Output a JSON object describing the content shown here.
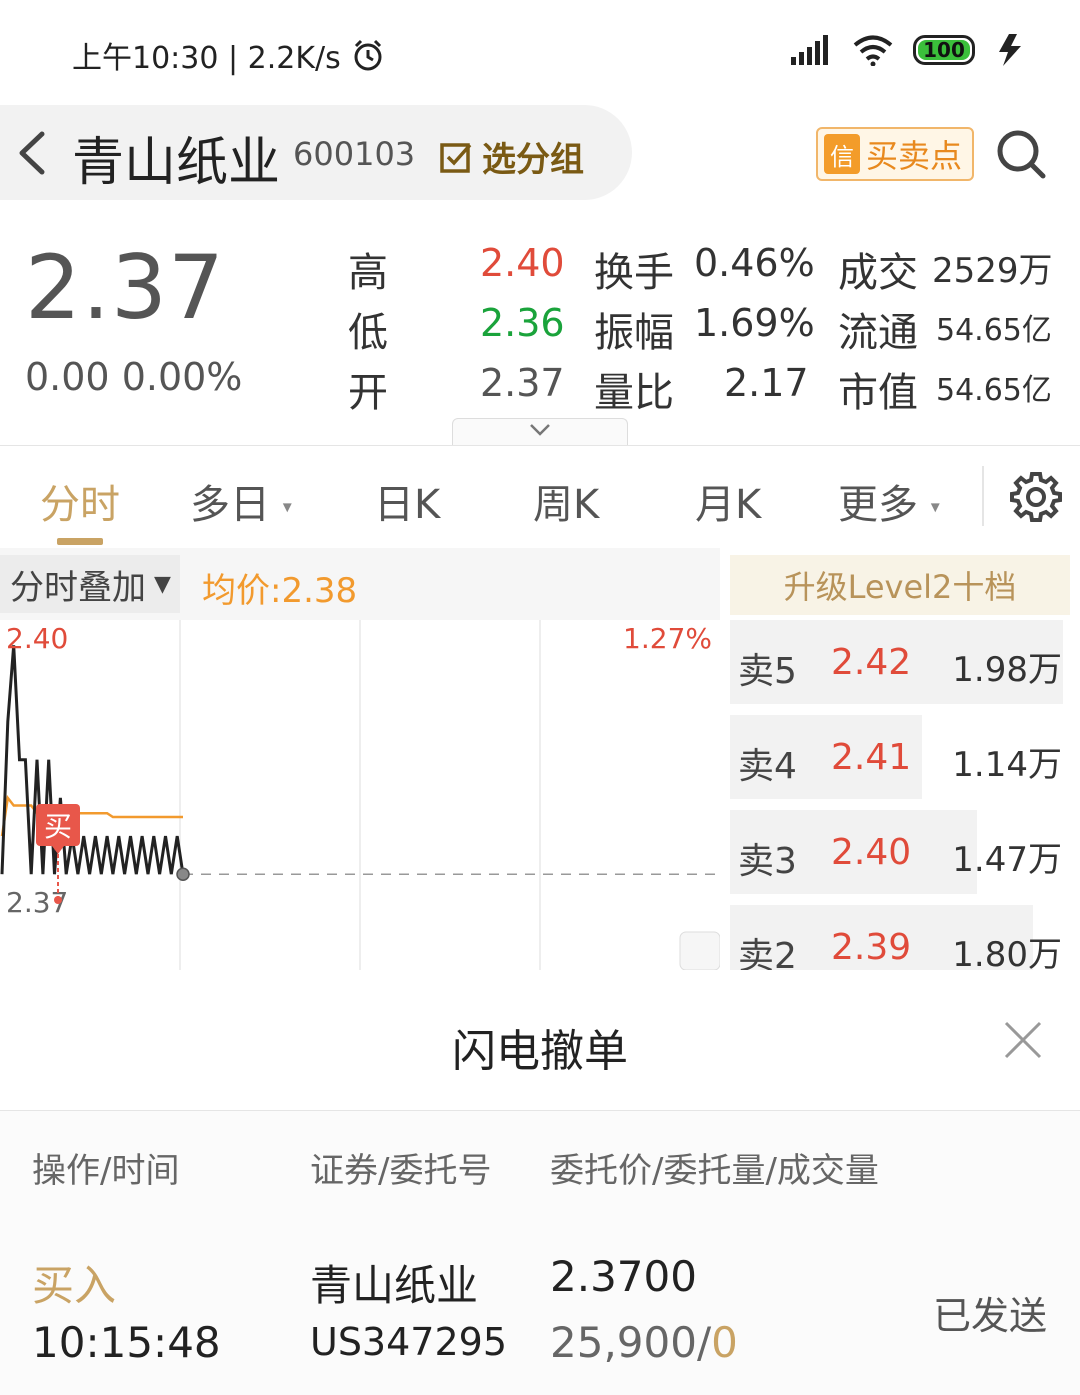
{
  "status_bar": {
    "time_speed": "上午10:30 | 2.2K/s",
    "battery": "100"
  },
  "header": {
    "stock_name": "青山纸业",
    "stock_code": "600103",
    "group_button": "选分组",
    "signal_badge": "信",
    "signal_button": "买卖点"
  },
  "quote": {
    "price": "2.37",
    "change": "0.00 0.00%",
    "stats": [
      {
        "label": "高",
        "value": "2.40"
      },
      {
        "label": "低",
        "value": "2.36"
      },
      {
        "label": "开",
        "value": "2.37"
      },
      {
        "label": "换手",
        "value": "0.46%"
      },
      {
        "label": "振幅",
        "value": "1.69%"
      },
      {
        "label": "量比",
        "value": "2.17"
      },
      {
        "label": "成交",
        "value": "2529万"
      },
      {
        "label": "流通",
        "value": "54.65亿"
      },
      {
        "label": "市值",
        "value": "54.65亿"
      }
    ]
  },
  "tabs": [
    "分时",
    "多日",
    "日K",
    "周K",
    "月K",
    "更多"
  ],
  "chart_head": {
    "overlay_button": "分时叠加",
    "avg_price": "均价:2.38"
  },
  "chart_data": {
    "type": "line",
    "y_high_label": "2.40",
    "y_low_label": "2.37",
    "pct_high_label": "1.27%",
    "buy_marker": "买",
    "price_series": [
      2.37,
      2.39,
      2.4,
      2.385,
      2.385,
      2.37,
      2.385,
      2.37,
      2.385,
      2.37,
      2.38,
      2.37,
      2.375,
      2.37,
      2.375,
      2.37,
      2.375,
      2.37,
      2.375,
      2.37,
      2.375,
      2.37,
      2.375,
      2.37,
      2.375,
      2.37,
      2.375,
      2.37,
      2.375,
      2.37,
      2.375,
      2.37
    ],
    "avg_series": [
      2.375,
      2.38,
      2.379,
      2.379,
      2.379,
      2.379,
      2.378,
      2.378,
      2.378,
      2.378,
      2.378,
      2.378,
      2.378,
      2.378,
      2.378,
      2.378,
      2.378,
      2.378,
      2.378,
      2.3775,
      2.3775,
      2.3775,
      2.3775,
      2.3775,
      2.3775,
      2.3775,
      2.3775,
      2.3775,
      2.3775,
      2.3775,
      2.3775,
      2.3775
    ],
    "prev_close": 2.37,
    "ylim": [
      2.364,
      2.402
    ],
    "colors": {
      "price": "#222222",
      "avg": "#f29a2e",
      "ref": "#999999"
    }
  },
  "order_book": {
    "upgrade_label": "升级Level2十档",
    "asks": [
      {
        "label": "卖5",
        "price": "2.42",
        "volume": "1.98万",
        "depth": 1.98
      },
      {
        "label": "卖4",
        "price": "2.41",
        "volume": "1.14万",
        "depth": 1.14
      },
      {
        "label": "卖3",
        "price": "2.40",
        "volume": "1.47万",
        "depth": 1.47
      },
      {
        "label": "卖2",
        "price": "2.39",
        "volume": "1.80万",
        "depth": 1.8
      }
    ]
  },
  "sheet": {
    "title": "闪电撤单",
    "col_headers": [
      "操作/时间",
      "证券/委托号",
      "委托价/委托量/成交量"
    ],
    "order": {
      "action": "买入",
      "time": "10:15:48",
      "security": "青山纸业",
      "order_no": "US347295",
      "price": "2.3700",
      "qty": "25,900/",
      "filled": "0",
      "status": "已发送"
    }
  },
  "colors": {
    "up": "#e04b3a",
    "down": "#1aa33b",
    "accent": "#c9a364",
    "avg": "#f29a2e"
  }
}
